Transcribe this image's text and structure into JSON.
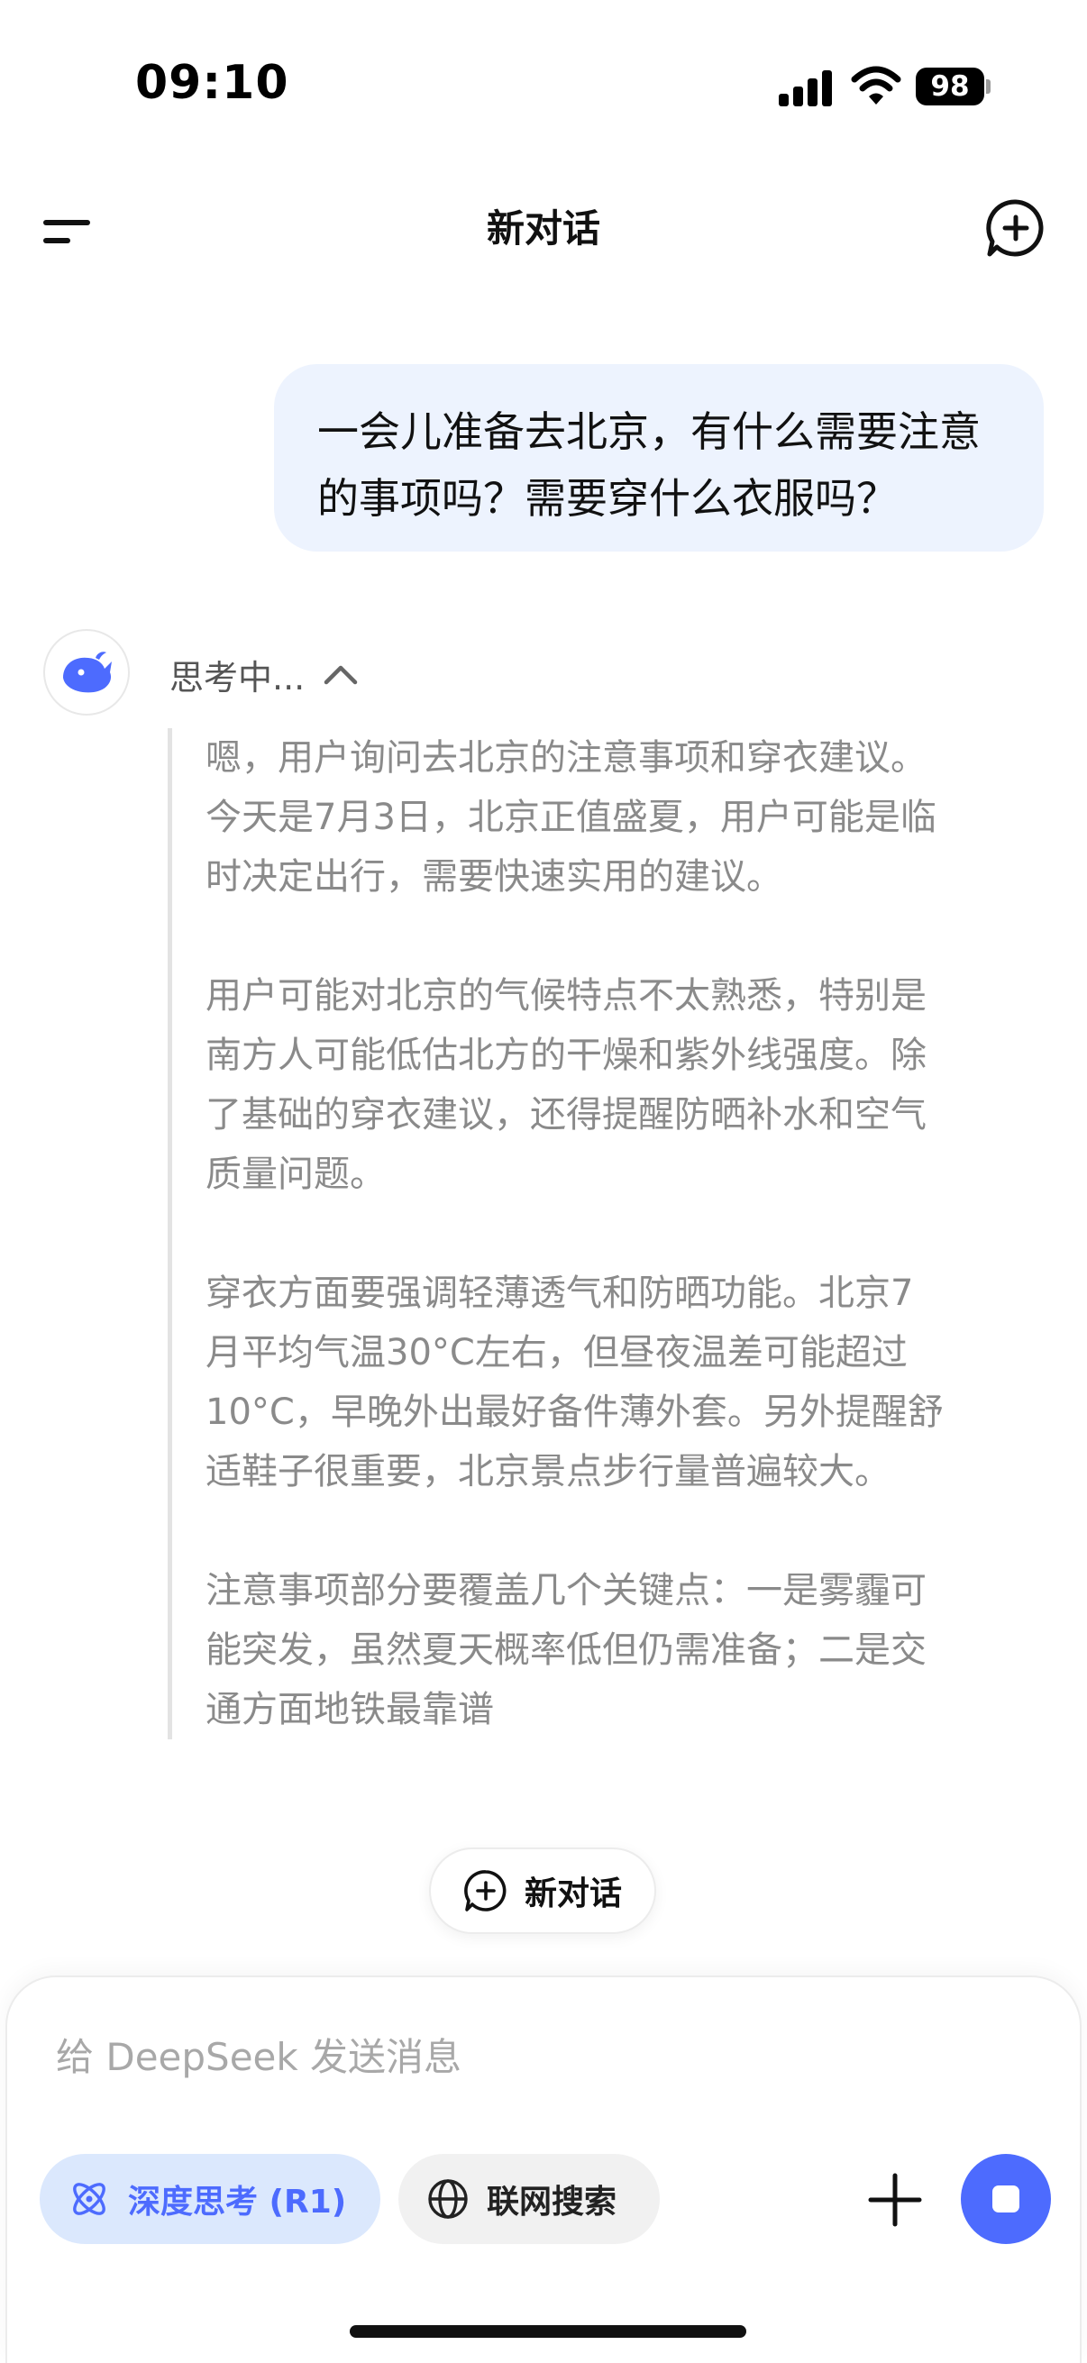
{
  "status_bar": {
    "time": "09:10",
    "battery": "98",
    "icons": [
      "signal-icon",
      "wifi-icon",
      "battery-icon"
    ]
  },
  "header": {
    "title": "新对话",
    "left_icon": "menu-icon",
    "right_icon": "new-chat-plus-icon"
  },
  "conversation": {
    "user_message": "一会儿准备去北京，有什么需要注意的事项吗？需要穿什么衣服吗？",
    "assistant": {
      "avatar_icon": "deepseek-whale-logo",
      "thinking_label": "思考中...",
      "thinking_toggle_icon": "chevron-up-icon",
      "thinking_paragraphs": [
        "嗯，用户询问去北京的注意事项和穿衣建议。\n今天是7月3日，北京正值盛夏，用户可能是临\n时决定出行，需要快速实用的建议。",
        "用户可能对北京的气候特点不太熟悉，特别是\n南方人可能低估北方的干燥和紫外线强度。除\n了基础的穿衣建议，还得提醒防晒补水和空气\n质量问题。",
        "穿衣方面要强调轻薄透气和防晒功能。北京7\n月平均气温30°C左右，但昼夜温差可能超过\n10°C，早晚外出最好备件薄外套。另外提醒舒\n适鞋子很重要，北京景点步行量普遍较大。",
        "注意事项部分要覆盖几个关键点：一是雾霾可\n能突发，虽然夏天概率低但仍需准备；二是交\n通方面地铁最靠谱"
      ]
    }
  },
  "new_chat_pill": {
    "label": "新对话",
    "icon": "plus-circle-icon"
  },
  "composer": {
    "placeholder": "给 DeepSeek 发送消息",
    "value": "",
    "deep_think": {
      "label": "深度思考 (R1)",
      "icon": "atom-icon",
      "active": true
    },
    "web_search": {
      "label": "联网搜索",
      "icon": "globe-icon",
      "active": false
    },
    "attach_icon": "plus-icon",
    "stop_icon": "stop-icon"
  },
  "colors": {
    "accent": "#4d6bfe",
    "user_bubble": "#edf3fe",
    "deep_think_bg": "#dbe8fd",
    "thinking_text": "#8a8a8a"
  }
}
